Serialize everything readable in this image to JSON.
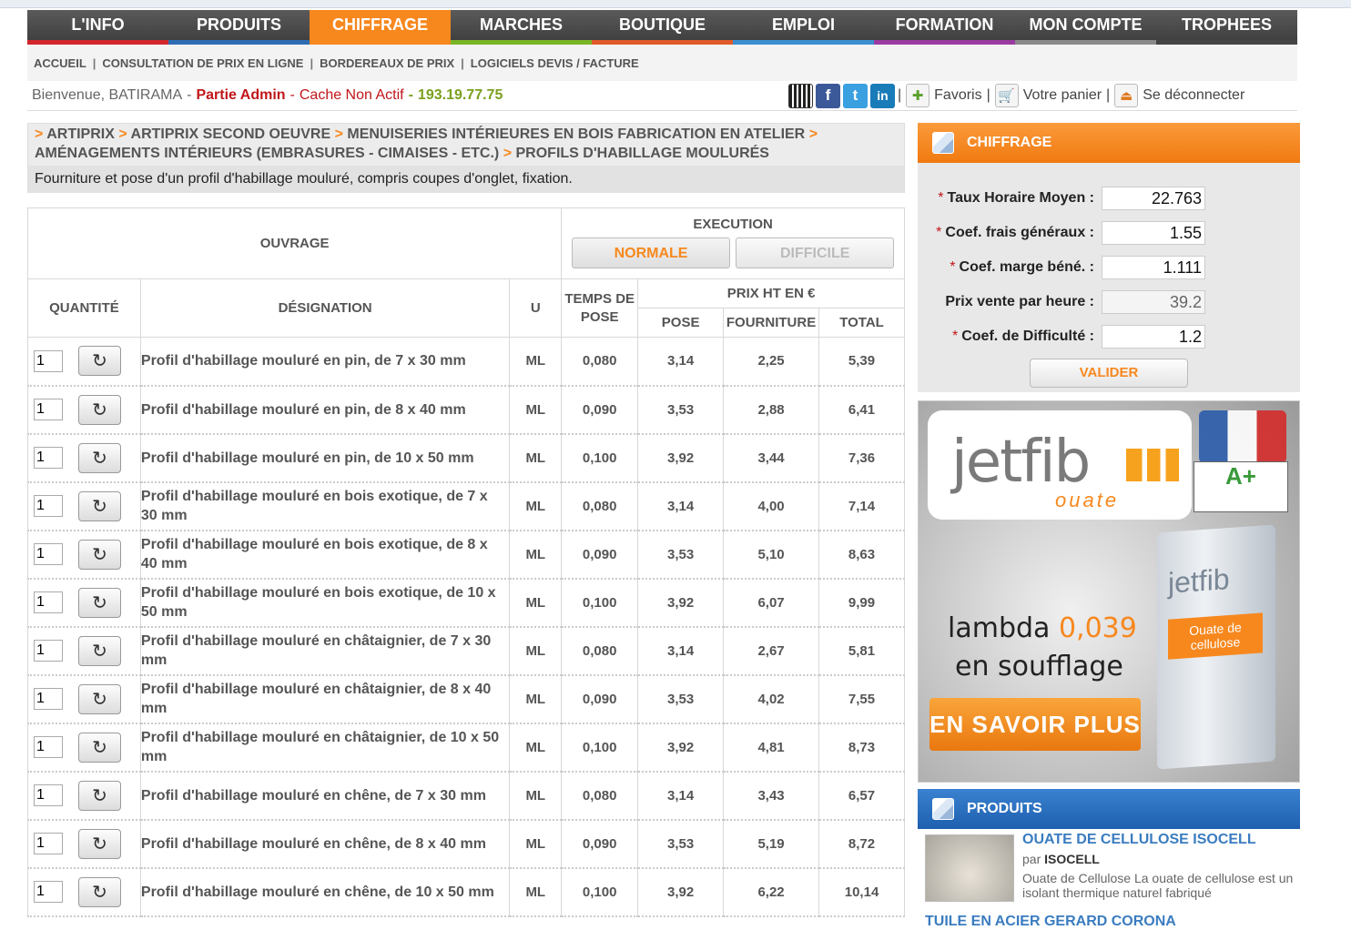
{
  "nav": {
    "items": [
      "L'INFO",
      "PRODUITS",
      "CHIFFRAGE",
      "MARCHES",
      "BOUTIQUE",
      "EMPLOI",
      "FORMATION",
      "MON COMPTE",
      "TROPHEES"
    ],
    "active": "CHIFFRAGE",
    "colors": [
      "#d1262b",
      "#2e6db4",
      "#f7881e",
      "#7ab526",
      "#e05a2a",
      "#3a8fd0",
      "#9b3aa0",
      "#8a8a8a",
      "#444444"
    ]
  },
  "subnav": [
    "ACCUEIL",
    "CONSULTATION DE PRIX EN LIGNE",
    "BORDEREAUX DE PRIX",
    "LOGICIELS DEVIS / FACTURE"
  ],
  "welcome": {
    "greeting": "Bienvenue, BATIRAMA",
    "admin": "Partie Admin",
    "cache": "Cache Non Actif",
    "ip": "193.19.77.75"
  },
  "toolbar": {
    "favoris": "Favoris",
    "panier": "Votre panier",
    "deconnecter": "Se déconnecter"
  },
  "breadcrumb": {
    "items": [
      "ARTIPRIX",
      "ARTIPRIX SECOND OEUVRE",
      "MENUISERIES INTÉRIEURES EN BOIS FABRICATION EN ATELIER",
      "AMÉNAGEMENTS INTÉRIEURS (EMBRASURES - CIMAISES - ETC.)",
      "PROFILS D'HABILLAGE MOULURÉS"
    ],
    "description": "Fourniture et pose d'un profil d'habillage mouluré, compris coupes d'onglet, fixation."
  },
  "table": {
    "ouvrage": "OUVRAGE",
    "execution": "EXECUTION",
    "normale": "NORMALE",
    "difficile": "DIFFICILE",
    "quantite": "QUANTITÉ",
    "designation": "DÉSIGNATION",
    "unite": "U",
    "temps": "TEMPS DE POSE",
    "prix": "PRIX HT EN €",
    "pose": "POSE",
    "fourniture": "FOURNITURE",
    "total": "TOTAL",
    "rows": [
      {
        "qty": "1",
        "des": "Profil d'habillage mouluré en pin, de 7 x 30 mm",
        "u": "ML",
        "temps": "0,080",
        "pose": "3,14",
        "four": "2,25",
        "total": "5,39"
      },
      {
        "qty": "1",
        "des": "Profil d'habillage mouluré en pin, de 8 x 40 mm",
        "u": "ML",
        "temps": "0,090",
        "pose": "3,53",
        "four": "2,88",
        "total": "6,41"
      },
      {
        "qty": "1",
        "des": "Profil d'habillage mouluré en pin, de 10 x 50 mm",
        "u": "ML",
        "temps": "0,100",
        "pose": "3,92",
        "four": "3,44",
        "total": "7,36"
      },
      {
        "qty": "1",
        "des": "Profil d'habillage mouluré en bois exotique, de 7 x 30 mm",
        "u": "ML",
        "temps": "0,080",
        "pose": "3,14",
        "four": "4,00",
        "total": "7,14"
      },
      {
        "qty": "1",
        "des": "Profil d'habillage mouluré en bois exotique, de 8 x 40 mm",
        "u": "ML",
        "temps": "0,090",
        "pose": "3,53",
        "four": "5,10",
        "total": "8,63"
      },
      {
        "qty": "1",
        "des": "Profil d'habillage mouluré en bois exotique, de 10 x 50 mm",
        "u": "ML",
        "temps": "0,100",
        "pose": "3,92",
        "four": "6,07",
        "total": "9,99"
      },
      {
        "qty": "1",
        "des": "Profil d'habillage mouluré en châtaignier, de 7 x 30 mm",
        "u": "ML",
        "temps": "0,080",
        "pose": "3,14",
        "four": "2,67",
        "total": "5,81"
      },
      {
        "qty": "1",
        "des": "Profil d'habillage mouluré en châtaignier, de 8 x 40 mm",
        "u": "ML",
        "temps": "0,090",
        "pose": "3,53",
        "four": "4,02",
        "total": "7,55"
      },
      {
        "qty": "1",
        "des": "Profil d'habillage mouluré en châtaignier, de 10 x 50 mm",
        "u": "ML",
        "temps": "0,100",
        "pose": "3,92",
        "four": "4,81",
        "total": "8,73"
      },
      {
        "qty": "1",
        "des": "Profil d'habillage mouluré en chêne, de 7 x 30 mm",
        "u": "ML",
        "temps": "0,080",
        "pose": "3,14",
        "four": "3,43",
        "total": "6,57"
      },
      {
        "qty": "1",
        "des": "Profil d'habillage mouluré en chêne, de 8 x 40 mm",
        "u": "ML",
        "temps": "0,090",
        "pose": "3,53",
        "four": "5,19",
        "total": "8,72"
      },
      {
        "qty": "1",
        "des": "Profil d'habillage mouluré en chêne, de 10 x 50 mm",
        "u": "ML",
        "temps": "0,100",
        "pose": "3,92",
        "four": "6,22",
        "total": "10,14"
      }
    ]
  },
  "chiffrage": {
    "title": "CHIFFRAGE",
    "taux_label": "Taux Horaire Moyen :",
    "taux": "22.763",
    "fg_label": "Coef. frais généraux :",
    "fg": "1.55",
    "marge_label": "Coef. marge béné. :",
    "marge": "1.111",
    "prix_label": "Prix vente par heure :",
    "prix": "39.2",
    "diff_label": "Coef. de Difficulté :",
    "diff": "1.2",
    "valider": "VALIDER"
  },
  "ad": {
    "brand": "jetfib",
    "brand_sub": "ouate",
    "badge": "A+",
    "line1_a": "lambda",
    "line1_b": "0,039",
    "line2": "en soufflage",
    "cta": "EN SAVOIR PLUS",
    "bag_brand": "jetfib",
    "bag_label": "Ouate de cellulose"
  },
  "produits": {
    "title": "PRODUITS",
    "item_title": "OUATE DE CELLULOSE ISOCELL",
    "item_by_prefix": "par",
    "item_by": "ISOCELL",
    "item_desc": "Ouate de Cellulose La ouate de cellulose est un isolant thermique naturel fabriqué",
    "next_title": "TUILE EN ACIER GERARD CORONA"
  }
}
